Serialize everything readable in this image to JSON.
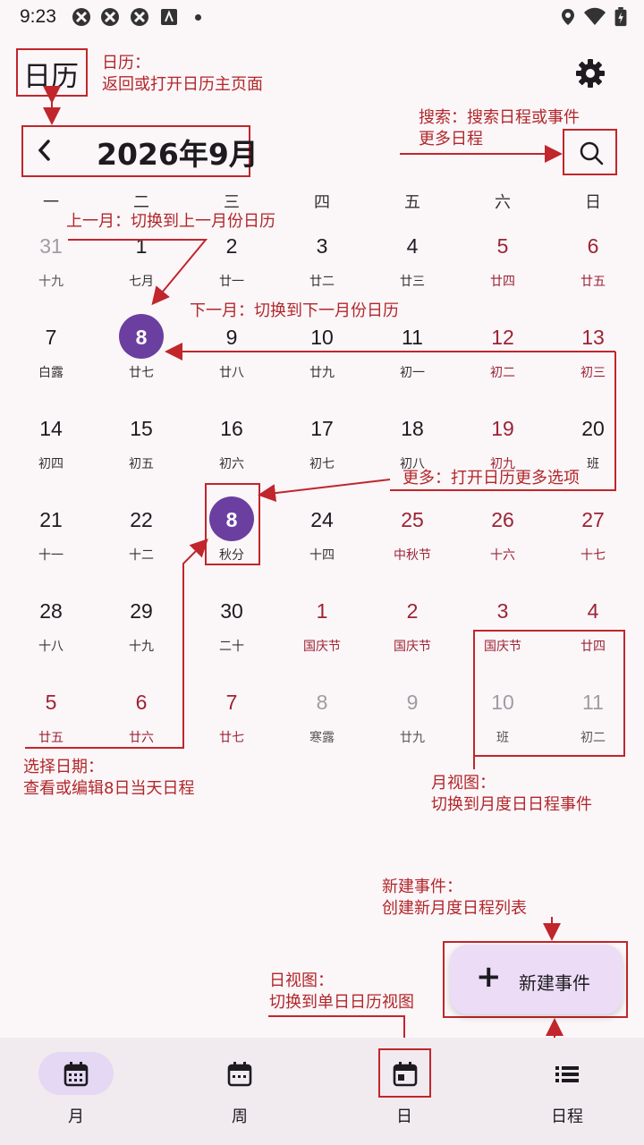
{
  "status": {
    "time": "9:23"
  },
  "header": {
    "app_title": "日历",
    "month_title": "2026年9月"
  },
  "weekdays": [
    "一",
    "二",
    "三",
    "四",
    "五",
    "六",
    "日"
  ],
  "calendar": [
    [
      {
        "d": "31",
        "l": "十九",
        "t": "gray"
      },
      {
        "d": "1",
        "l": "七月",
        "t": ""
      },
      {
        "d": "2",
        "l": "廿一",
        "t": ""
      },
      {
        "d": "3",
        "l": "廿二",
        "t": ""
      },
      {
        "d": "4",
        "l": "廿三",
        "t": ""
      },
      {
        "d": "5",
        "l": "廿四",
        "t": "red"
      },
      {
        "d": "6",
        "l": "廿五",
        "t": "red"
      }
    ],
    [
      {
        "d": "7",
        "l": "白露",
        "t": ""
      },
      {
        "d": "8",
        "l": "廿七",
        "t": "sel"
      },
      {
        "d": "9",
        "l": "廿八",
        "t": ""
      },
      {
        "d": "10",
        "l": "廿九",
        "t": ""
      },
      {
        "d": "11",
        "l": "初一",
        "t": ""
      },
      {
        "d": "12",
        "l": "初二",
        "t": "red"
      },
      {
        "d": "13",
        "l": "初三",
        "t": "red"
      }
    ],
    [
      {
        "d": "14",
        "l": "初四",
        "t": ""
      },
      {
        "d": "15",
        "l": "初五",
        "t": ""
      },
      {
        "d": "16",
        "l": "初六",
        "t": ""
      },
      {
        "d": "17",
        "l": "初七",
        "t": ""
      },
      {
        "d": "18",
        "l": "初八",
        "t": ""
      },
      {
        "d": "19",
        "l": "初九",
        "t": "red"
      },
      {
        "d": "20",
        "l": "班",
        "t": ""
      }
    ],
    [
      {
        "d": "21",
        "l": "十一",
        "t": ""
      },
      {
        "d": "22",
        "l": "十二",
        "t": ""
      },
      {
        "d": "8",
        "l": "秋分",
        "t": "sel"
      },
      {
        "d": "24",
        "l": "十四",
        "t": ""
      },
      {
        "d": "25",
        "l": "中秋节",
        "t": "red"
      },
      {
        "d": "26",
        "l": "十六",
        "t": "red"
      },
      {
        "d": "27",
        "l": "十七",
        "t": "red"
      }
    ],
    [
      {
        "d": "28",
        "l": "十八",
        "t": ""
      },
      {
        "d": "29",
        "l": "十九",
        "t": ""
      },
      {
        "d": "30",
        "l": "二十",
        "t": ""
      },
      {
        "d": "1",
        "l": "国庆节",
        "t": "red"
      },
      {
        "d": "2",
        "l": "国庆节",
        "t": "red"
      },
      {
        "d": "3",
        "l": "国庆节",
        "t": "red"
      },
      {
        "d": "4",
        "l": "廿四",
        "t": "red"
      }
    ],
    [
      {
        "d": "5",
        "l": "廿五",
        "t": "red"
      },
      {
        "d": "6",
        "l": "廿六",
        "t": "red"
      },
      {
        "d": "7",
        "l": "廿七",
        "t": "red"
      },
      {
        "d": "8",
        "l": "寒露",
        "t": "gray"
      },
      {
        "d": "9",
        "l": "廿九",
        "t": "gray"
      },
      {
        "d": "10",
        "l": "班",
        "t": "gray"
      },
      {
        "d": "11",
        "l": "初二",
        "t": "gray"
      }
    ]
  ],
  "annotations": {
    "title_1": "日历：",
    "title_2": "返回或打开日历主页面",
    "search_1": "搜索：搜索日程或事件",
    "search_2": "更多日程",
    "prev": "上一月：切换到上一月份日历",
    "next": "下一月：切换到下一月份日历",
    "more": "更多：打开日历更多选项",
    "select_1": "选择日期：",
    "select_2": "查看或编辑8日当天日程",
    "monthview_1": "月视图：",
    "monthview_2": "切换到月度日日程事件",
    "newevent_1": "新建事件：",
    "newevent_2": "创建新月度日程列表",
    "dayview_1": "日视图：",
    "dayview_2": "切换到单日日历视图"
  },
  "fab": {
    "label": "新建事件"
  },
  "nav": [
    {
      "label": "月",
      "icon": "calendar-month-icon"
    },
    {
      "label": "周",
      "icon": "calendar-week-icon"
    },
    {
      "label": "日",
      "icon": "calendar-day-icon"
    },
    {
      "label": "日程",
      "icon": "list-icon"
    }
  ],
  "colors": {
    "accent": "#6b3fa0",
    "annotation": "#c0262c",
    "holiday": "#9b2335"
  }
}
